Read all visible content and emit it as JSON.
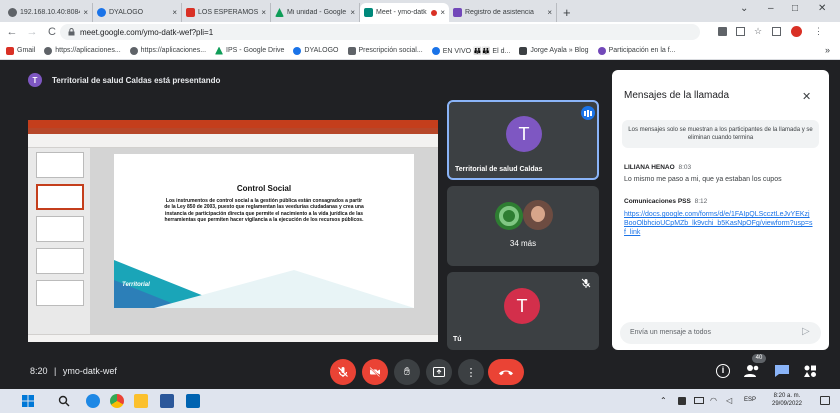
{
  "browser": {
    "tabs": [
      {
        "label": "192.168.10.40:8084/",
        "close": "×",
        "color": "#5f6368"
      },
      {
        "label": "DYALOGO",
        "close": "×",
        "color": "#1a73e8"
      },
      {
        "label": "LOS ESPERAMOS. Cla",
        "close": "×",
        "color": "#d93025"
      },
      {
        "label": "Mi unidad - Google D",
        "close": "×",
        "color": "#0f9d58"
      },
      {
        "label": "Meet - ymo-datk",
        "close": "×",
        "color": "#00897b",
        "active": true
      },
      {
        "label": "Registro de asistencia",
        "close": "×",
        "color": "#7248b9"
      }
    ],
    "new_tab": "+",
    "window_controls": {
      "chevron": "⌄",
      "minimize": "–",
      "maximize": "□",
      "close": "✕"
    },
    "nav": {
      "back": "←",
      "forward": "→",
      "reload": "C"
    },
    "url": "meet.google.com/ymo-datk-wef?pli=1",
    "bookmarks": [
      {
        "label": "Gmail",
        "color": "#d93025"
      },
      {
        "label": "https://aplicaciones...",
        "color": "#5f6368"
      },
      {
        "label": "https://aplicaciones...",
        "color": "#5f6368"
      },
      {
        "label": "IPS - Google Drive",
        "color": "#0f9d58"
      },
      {
        "label": "DYALOGO",
        "color": "#1a73e8"
      },
      {
        "label": "Prescripción social...",
        "color": "#5f6368"
      },
      {
        "label": "EN VIVO 👪👪 El d...",
        "color": "#1a73e8"
      },
      {
        "label": "Jorge Ayala » Blog",
        "color": "#3c4043"
      },
      {
        "label": "Participación en la f...",
        "color": "#7248b9"
      }
    ],
    "more": "»"
  },
  "meet": {
    "presenting_initial": "T",
    "presenting_text": "Territorial de salud Caldas está presentando",
    "slide": {
      "title": "Control Social",
      "body": "Los instrumentos de control social a la gestión pública están consagrados a partir de la Ley 850 de 2003, puesto que reglamentan las veedurías ciudadanas y crea una instancia de participación directa que permite el nacimiento a la vida jurídica de las herramientas que permiten hacer vigilancia a la ejecución de los recursos públicos.",
      "logo": "Territorial"
    },
    "tiles": {
      "presenter": {
        "initial": "T",
        "name": "Territorial de salud Caldas",
        "avatar_color": "#7e57c2"
      },
      "others": {
        "label": "34 más"
      },
      "self": {
        "initial": "T",
        "name": "Tú",
        "avatar_color": "#d32f4b"
      }
    },
    "panel": {
      "title": "Mensajes de la llamada",
      "close": "✕",
      "notice": "Los mensajes solo se muestran a los participantes de la llamada y se eliminan cuando termina",
      "messages": [
        {
          "author": "LILIANA HENAO",
          "time": "8:03",
          "text": "Lo mismo me paso a mi, que ya estaban los cupos"
        },
        {
          "author": "Comunicaciones PSS",
          "time": "8:12",
          "text": "https://docs.google.com/forms/d/e/1FAIpQLSccztLeJvYEKzjBooOlbhcioUCpMZb_lk9vchi_b5KasNpOFg/viewform?usp=sf_link"
        }
      ],
      "input_placeholder": "Envía un mensaje a todos",
      "send": "▷"
    },
    "bottom": {
      "time": "8:20",
      "separator": "|",
      "meeting_code": "ymo-datk-wef",
      "participant_count": "40"
    }
  },
  "taskbar": {
    "time": "8:20 a. m.",
    "date": "29/09/2022",
    "lang": "ESP"
  }
}
